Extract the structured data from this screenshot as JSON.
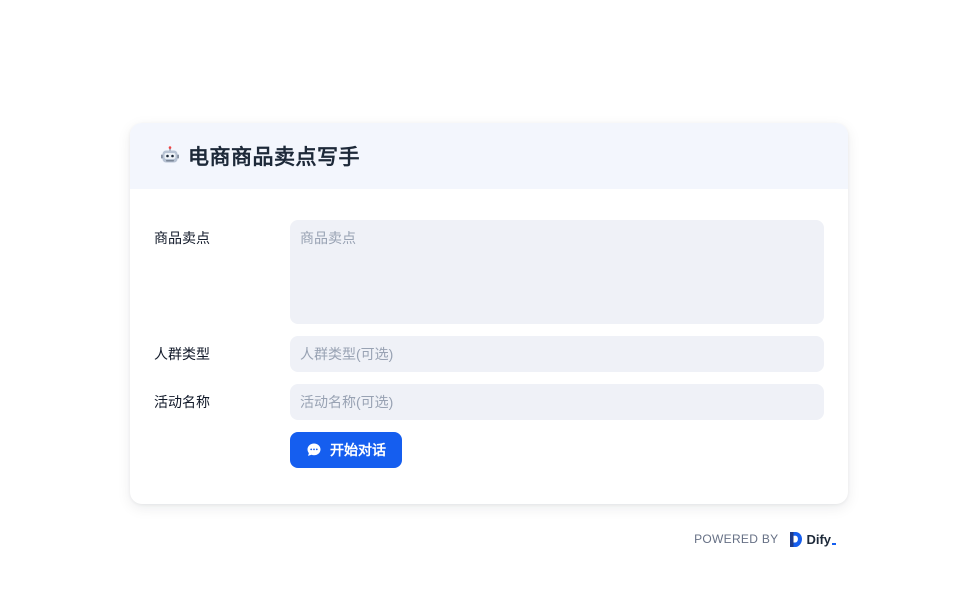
{
  "app": {
    "title": "电商商品卖点写手",
    "icon": "robot-icon"
  },
  "form": {
    "fields": [
      {
        "label": "商品卖点",
        "placeholder": "商品卖点",
        "value": "",
        "type": "textarea"
      },
      {
        "label": "人群类型",
        "placeholder": "人群类型(可选)",
        "value": "",
        "type": "text"
      },
      {
        "label": "活动名称",
        "placeholder": "活动名称(可选)",
        "value": "",
        "type": "text"
      }
    ],
    "start_button": {
      "label": "开始对话",
      "icon": "chat-bubble-icon"
    }
  },
  "footer": {
    "powered_by": "POWERED BY",
    "brand": "Dify"
  },
  "colors": {
    "accent": "#155eef",
    "header_bg": "#f3f6fd",
    "field_bg": "#eff1f7"
  }
}
